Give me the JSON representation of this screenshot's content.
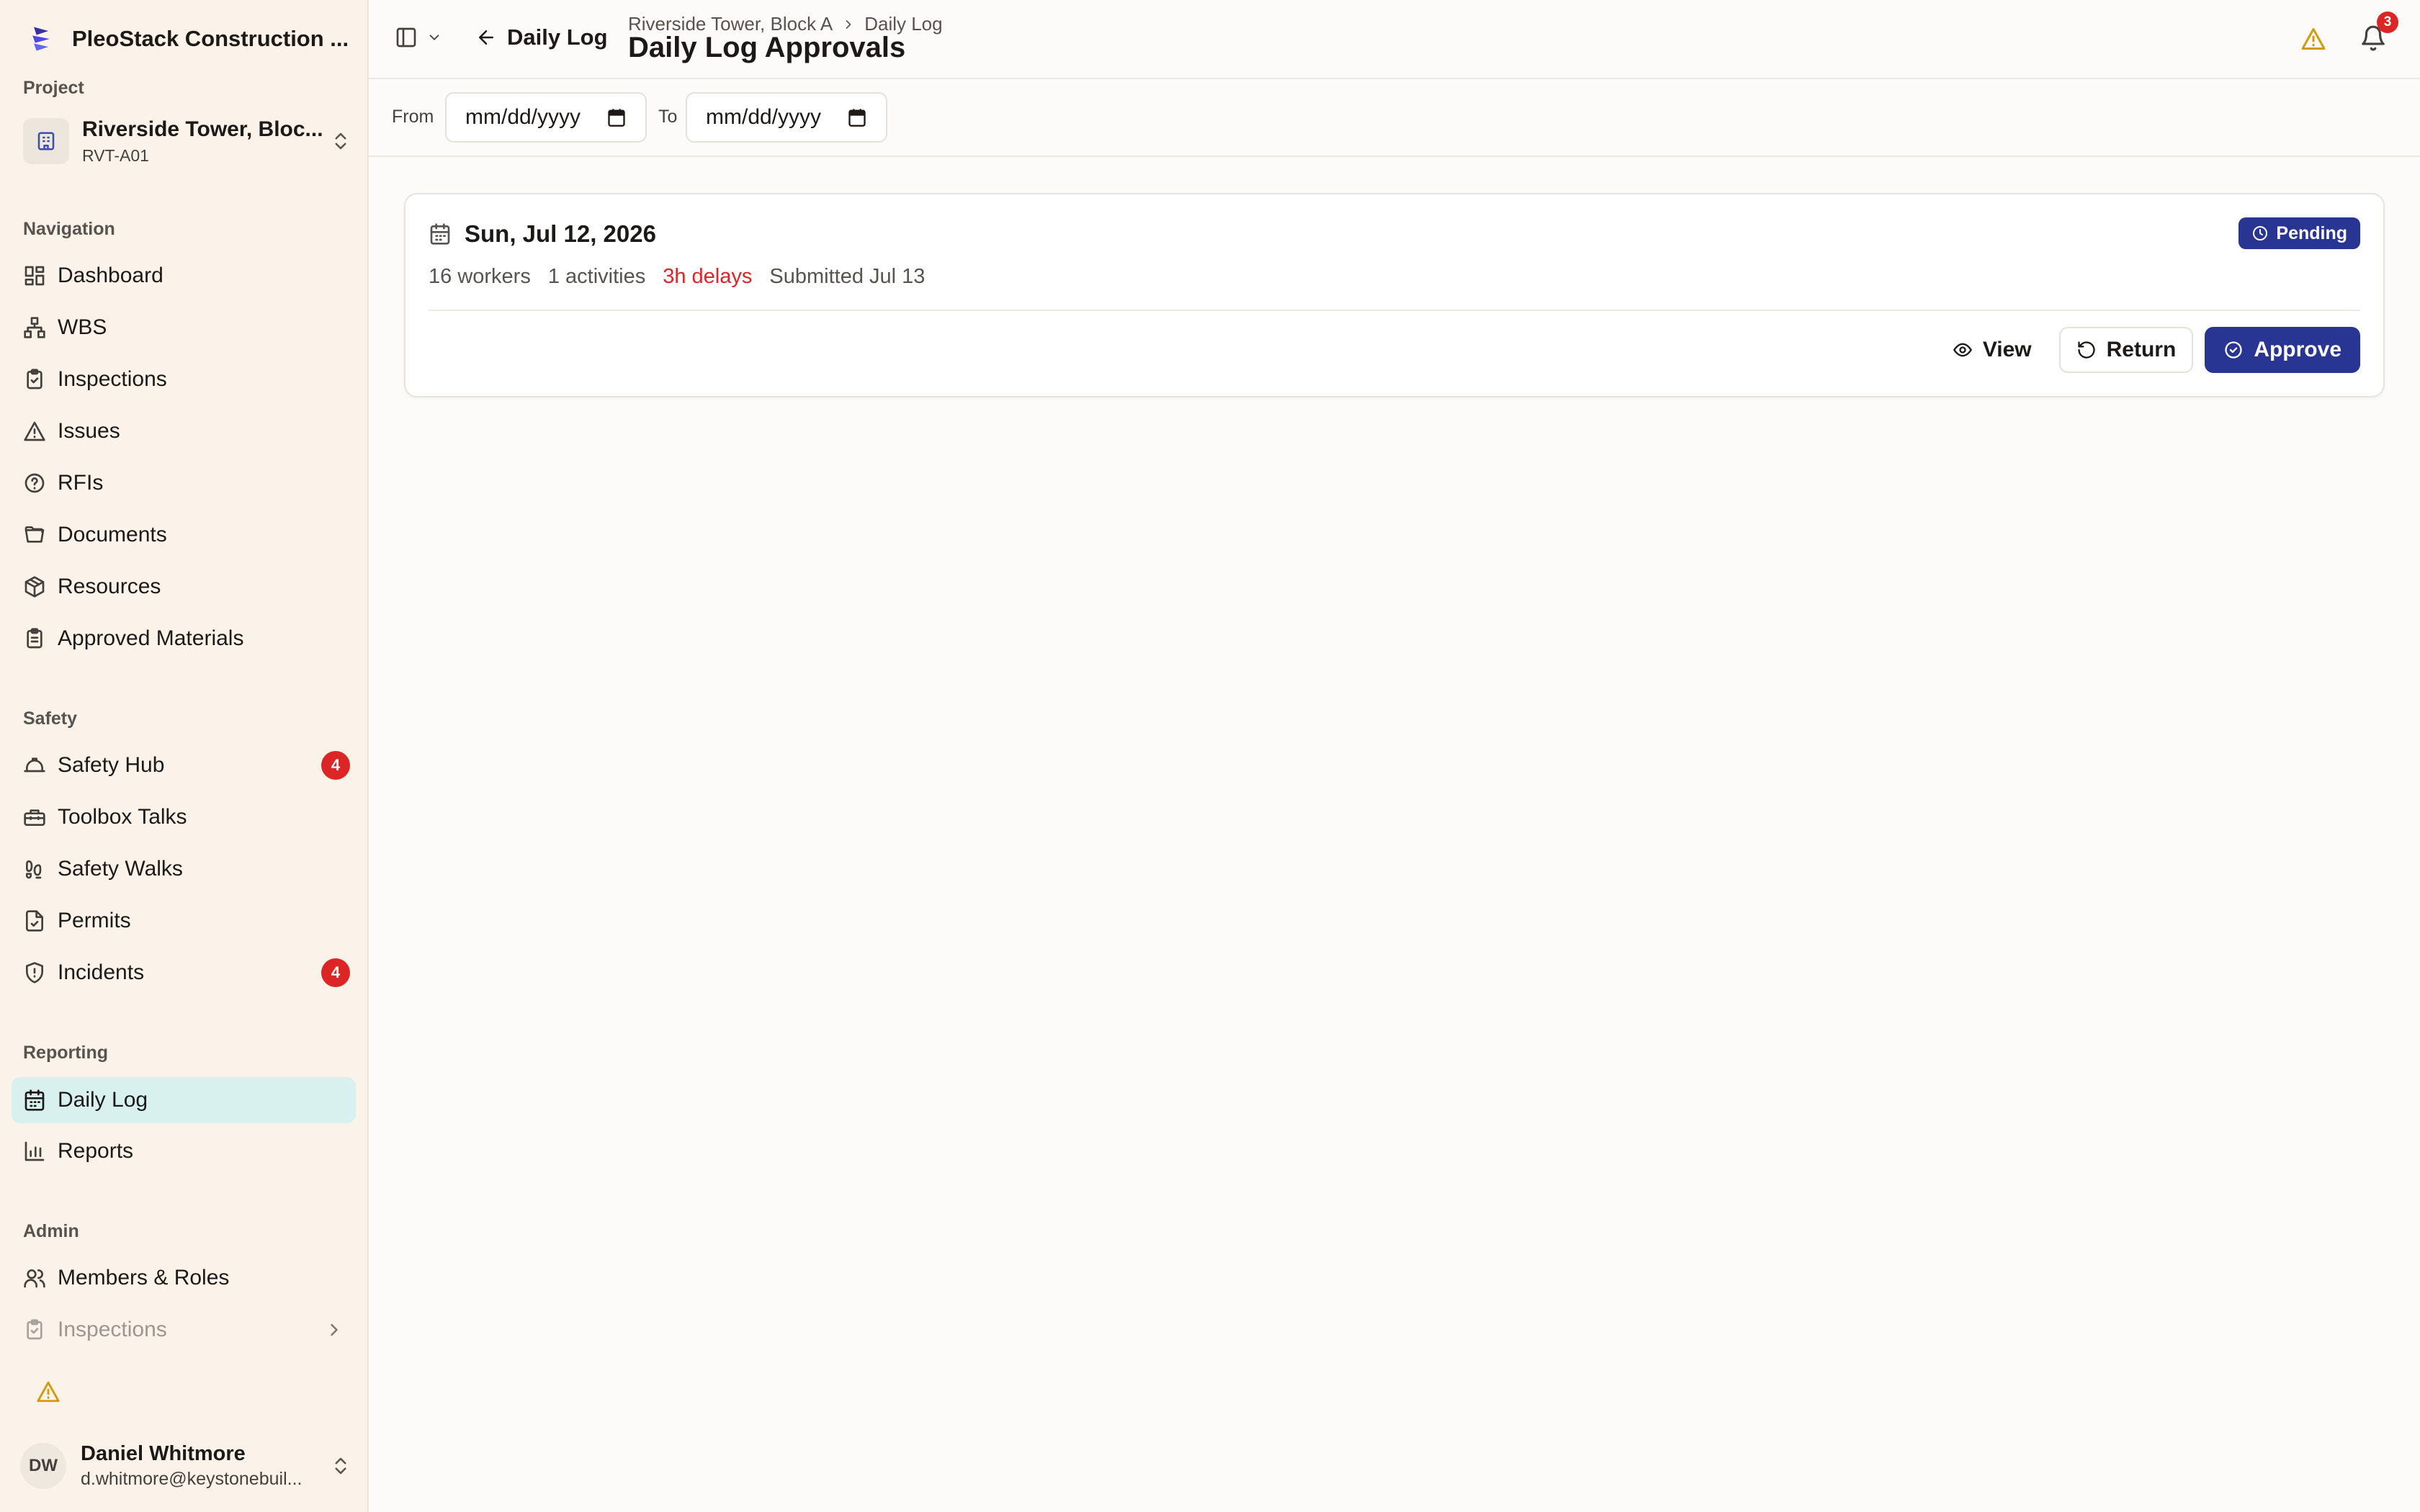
{
  "app": {
    "brand_name": "PleoStack Construction ..."
  },
  "sidebar": {
    "project_label": "Project",
    "project": {
      "name": "Riverside Tower, Bloc...",
      "code": "RVT-A01"
    },
    "sections": {
      "navigation": "Navigation",
      "safety": "Safety",
      "reporting": "Reporting",
      "admin": "Admin"
    },
    "navigation_items": [
      {
        "label": "Dashboard",
        "icon": "dashboard-icon"
      },
      {
        "label": "WBS",
        "icon": "hierarchy-icon"
      },
      {
        "label": "Inspections",
        "icon": "clipboard-check-icon"
      },
      {
        "label": "Issues",
        "icon": "warning-triangle-icon"
      },
      {
        "label": "RFIs",
        "icon": "help-circle-icon"
      },
      {
        "label": "Documents",
        "icon": "folder-icon"
      },
      {
        "label": "Resources",
        "icon": "package-icon"
      },
      {
        "label": "Approved Materials",
        "icon": "clipboard-list-icon"
      }
    ],
    "safety_items": [
      {
        "label": "Safety Hub",
        "icon": "hard-hat-icon",
        "badge": "4"
      },
      {
        "label": "Toolbox Talks",
        "icon": "toolbox-icon"
      },
      {
        "label": "Safety Walks",
        "icon": "footprints-icon"
      },
      {
        "label": "Permits",
        "icon": "file-check-icon"
      },
      {
        "label": "Incidents",
        "icon": "shield-alert-icon",
        "badge": "4"
      }
    ],
    "reporting_items": [
      {
        "label": "Daily Log",
        "icon": "calendar-icon",
        "active": true
      },
      {
        "label": "Reports",
        "icon": "bar-chart-icon"
      }
    ],
    "admin_items": [
      {
        "label": "Members & Roles",
        "icon": "users-icon"
      },
      {
        "label": "Inspections",
        "icon": "clipboard-check-icon"
      }
    ],
    "user": {
      "initials": "DW",
      "name": "Daniel Whitmore",
      "email": "d.whitmore@keystonebuil..."
    }
  },
  "header": {
    "back_label": "Daily Log",
    "breadcrumb": [
      "Riverside Tower, Block A",
      "Daily Log"
    ],
    "title": "Daily Log Approvals",
    "notification_count": "3"
  },
  "filters": {
    "from_label": "From",
    "to_label": "To",
    "from_value": "mm/dd/yyyy",
    "to_value": "mm/dd/yyyy"
  },
  "log_entries": [
    {
      "date": "Sun, Jul 12, 2026",
      "status": "Pending",
      "workers": "16 workers",
      "activities": "1 activities",
      "delays": "3h delays",
      "submitted": "Submitted Jul 13",
      "actions": {
        "view": "View",
        "return": "Return",
        "approve": "Approve"
      }
    }
  ],
  "colors": {
    "primary": "#283593",
    "danger": "#dc2626",
    "warning": "#d39a0b",
    "sidebar_bg": "#fbf3ea",
    "active_item_bg": "#d8f0ee"
  }
}
